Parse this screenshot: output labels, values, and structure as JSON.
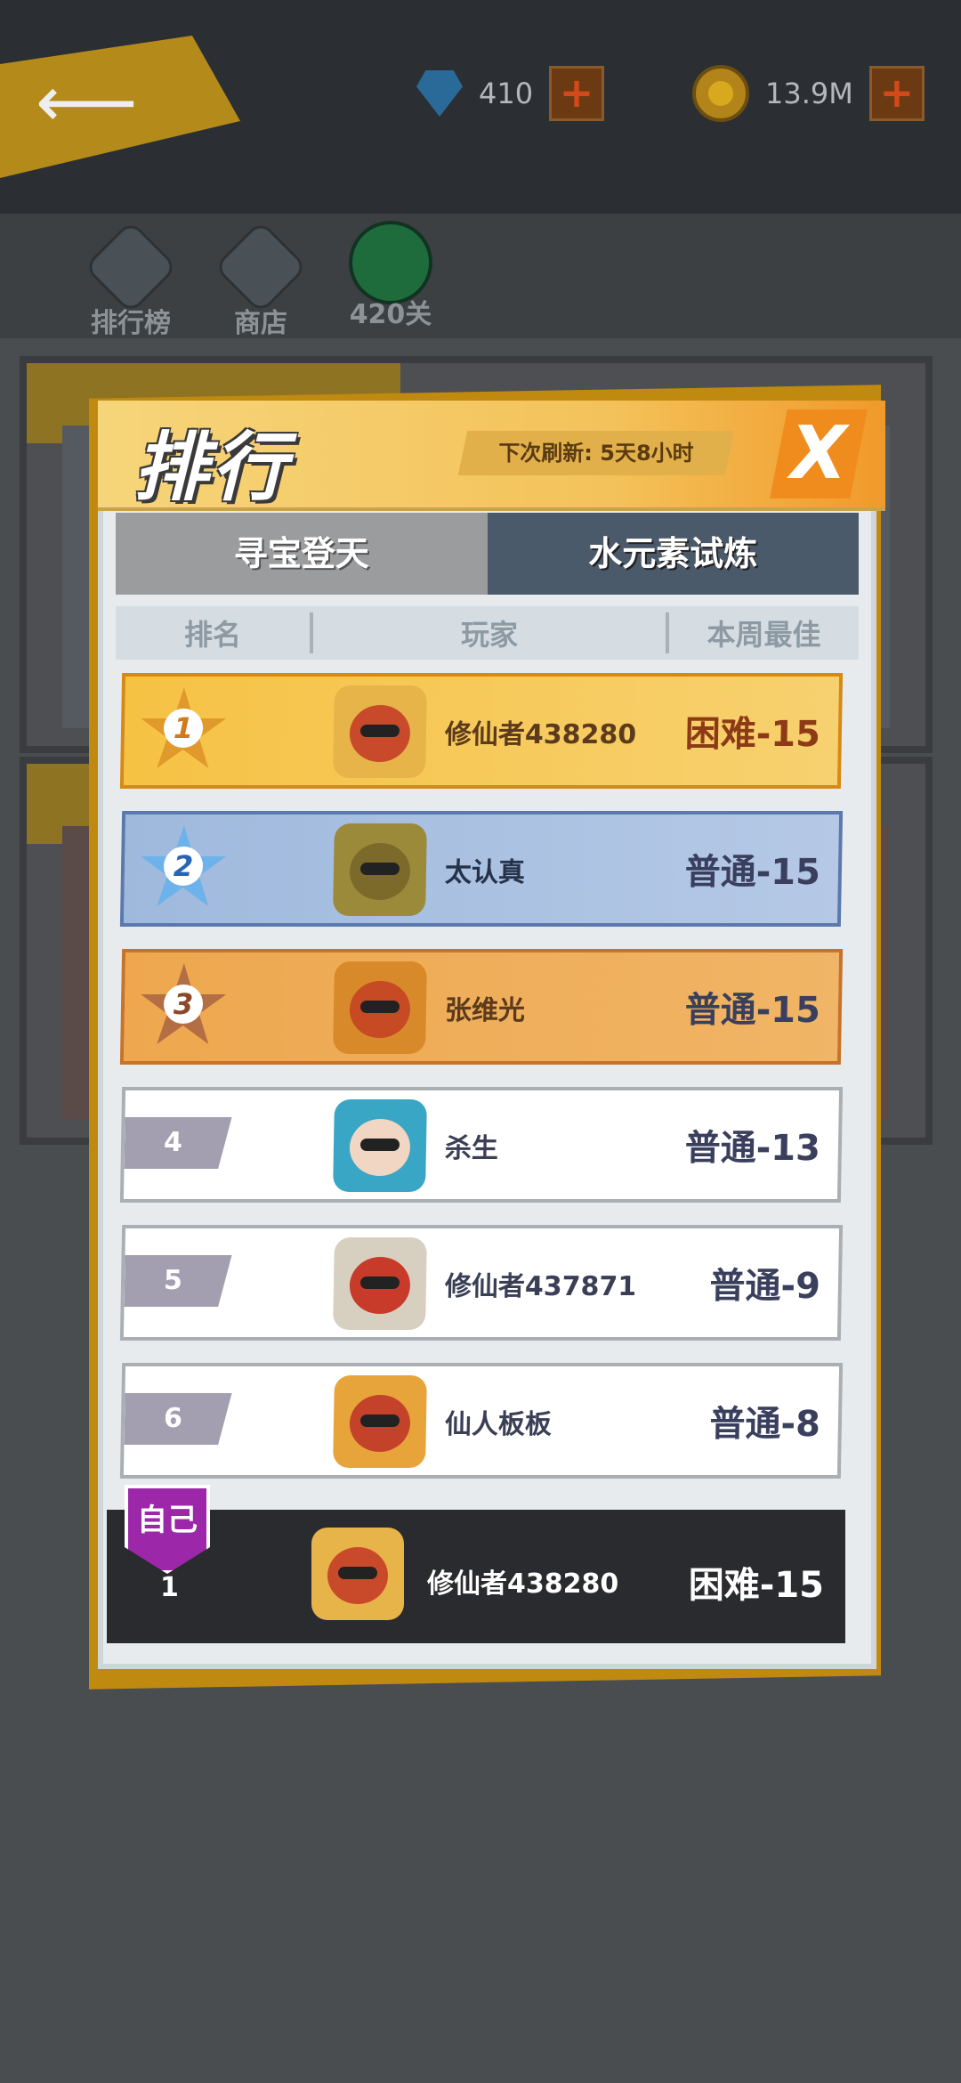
{
  "currency": {
    "gems": "410",
    "coins": "13.9M"
  },
  "nav": {
    "leaderboard": "排行榜",
    "shop": "商店",
    "level": "420关"
  },
  "modal": {
    "title": "排行",
    "refresh": "下次刷新: 5天8小时",
    "close": "X",
    "tabs": [
      "寻宝登天",
      "水元素试炼"
    ],
    "active_tab": "水元素试炼",
    "columns": [
      "排名",
      "玩家",
      "本周最佳"
    ]
  },
  "rows": [
    {
      "rank": "1",
      "player": "修仙者438280",
      "best": "困难-15"
    },
    {
      "rank": "2",
      "player": "太认真",
      "best": "普通-15"
    },
    {
      "rank": "3",
      "player": "张维光",
      "best": "普通-15"
    },
    {
      "rank": "4",
      "player": "杀生",
      "best": "普通-13"
    },
    {
      "rank": "5",
      "player": "修仙者437871",
      "best": "普通-9"
    },
    {
      "rank": "6",
      "player": "仙人板板",
      "best": "普通-8"
    }
  ],
  "self": {
    "badge": "自己",
    "rank": "1",
    "player": "修仙者438280",
    "best": "困难-15"
  },
  "colors": {
    "gold": "#f6c244",
    "silver": "#9fb9dd",
    "bronze": "#eea74e",
    "self_badge": "#9c28a9"
  }
}
